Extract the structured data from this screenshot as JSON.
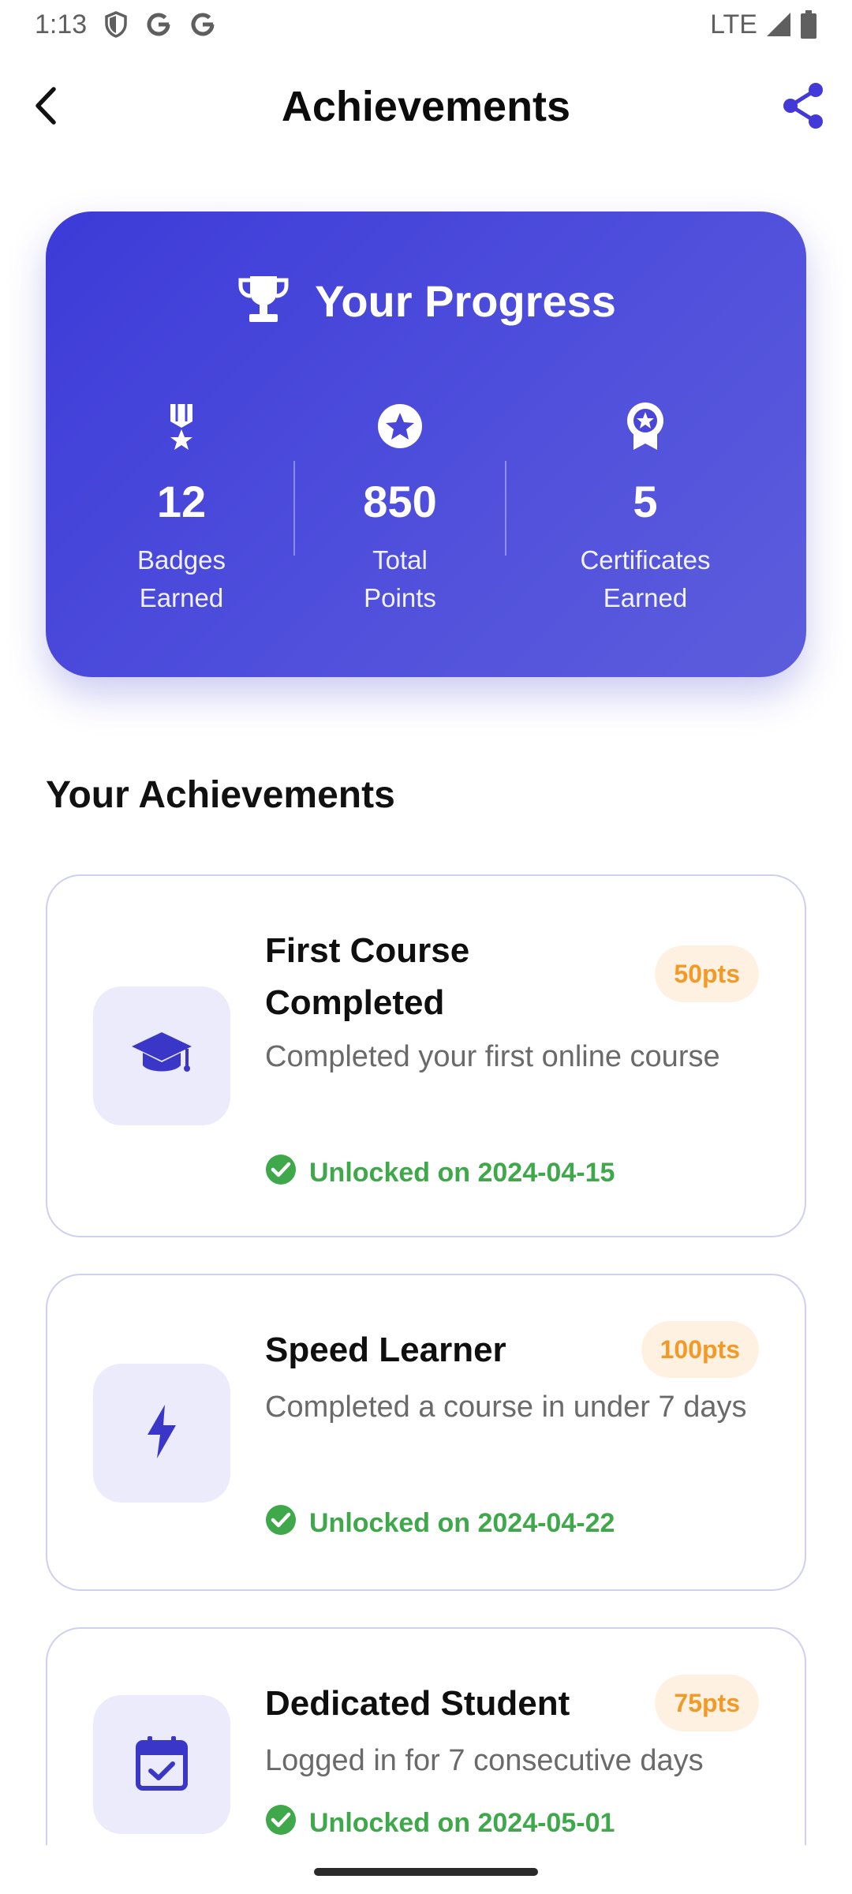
{
  "status_bar": {
    "time": "1:13",
    "network": "LTE",
    "left_icons": [
      "shield-icon",
      "google-icon",
      "google-icon"
    ],
    "right_icons": [
      "signal-icon",
      "battery-icon"
    ]
  },
  "app_bar": {
    "title": "Achievements",
    "back_icon": "arrow-back-icon",
    "share_icon": "share-icon",
    "accent_color": "#4338d8"
  },
  "progress": {
    "title": "Your Progress",
    "title_icon": "trophy-icon",
    "stats": [
      {
        "icon": "medal-icon",
        "value": "12",
        "label": "Badges\nEarned"
      },
      {
        "icon": "star-circle-icon",
        "value": "850",
        "label": "Total\nPoints"
      },
      {
        "icon": "award-ribbon-icon",
        "value": "5",
        "label": "Certificates\nEarned"
      }
    ],
    "gradient_colors": [
      "#3d3bd8",
      "#5c5ddc"
    ]
  },
  "achievements_section": {
    "title": "Your Achievements",
    "items": [
      {
        "icon": "graduation-cap-icon",
        "title": "First Course\nCompleted",
        "points": "50pts",
        "description": "Completed your first online course",
        "unlocked": "Unlocked on 2024-04-15"
      },
      {
        "icon": "lightning-bolt-icon",
        "title": "Speed Learner",
        "points": "100pts",
        "description": "Completed a course in under 7 days",
        "unlocked": "Unlocked on 2024-04-22"
      },
      {
        "icon": "calendar-check-icon",
        "title": "Dedicated Student",
        "points": "75pts",
        "description": "Logged in for 7 consecutive days",
        "unlocked": "Unlocked on 2024-05-01"
      }
    ],
    "status_color": "#3ea84a",
    "points_color": "#f29a28"
  }
}
